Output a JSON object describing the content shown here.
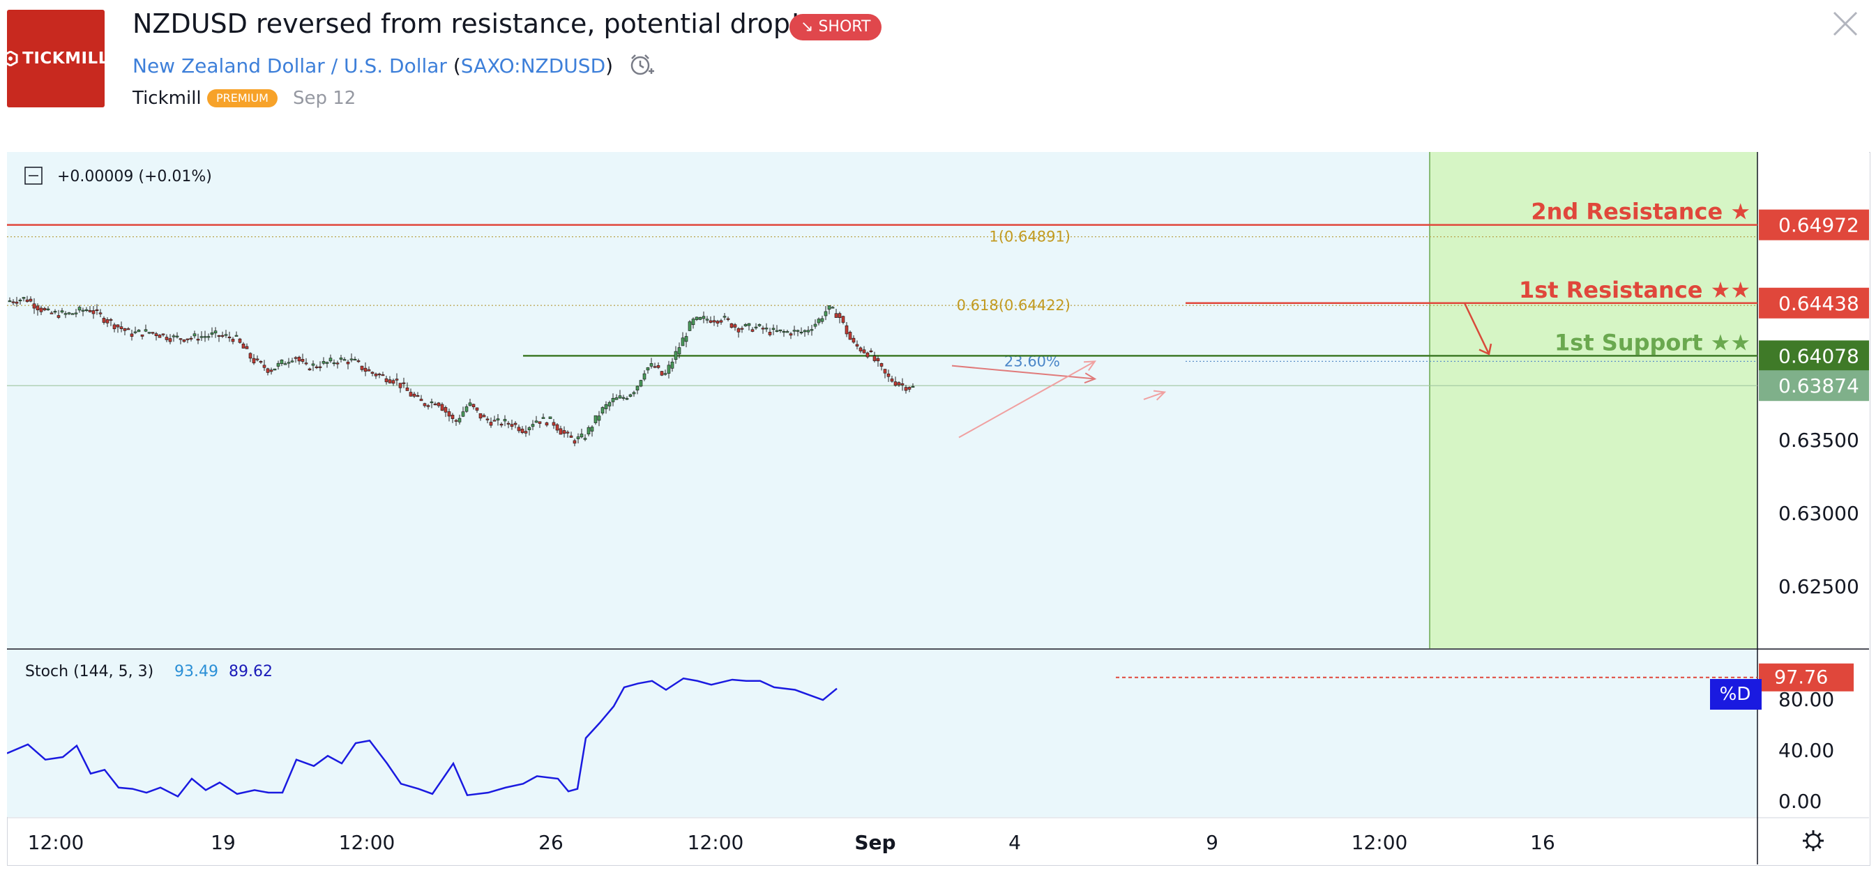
{
  "header": {
    "logo_text": "TICKMILL",
    "title": "NZDUSD reversed from resistance, potential drop!",
    "direction_badge": "SHORT",
    "symbol_name": "New Zealand Dollar / U.S. Dollar",
    "symbol_code": "SAXO:NZDUSD",
    "author": "Tickmill",
    "author_badge": "PREMIUM",
    "date": "Sep 12"
  },
  "chart_data": {
    "type": "candlestick",
    "change_label": "+0.00009 (+0.01%)",
    "yaxis_ticks": [
      "0.63500",
      "0.63000",
      "0.62500"
    ],
    "ylim": [
      0.6208,
      0.6547
    ],
    "xaxis_ticks": [
      "12:00",
      "19",
      "12:00",
      "26",
      "12:00",
      "Sep",
      "4",
      "9",
      "12:00",
      "16"
    ],
    "price_path": [
      [
        0,
        0.6445
      ],
      [
        30,
        0.6447
      ],
      [
        60,
        0.6437
      ],
      [
        90,
        0.6436
      ],
      [
        120,
        0.644
      ],
      [
        150,
        0.6431
      ],
      [
        180,
        0.6423
      ],
      [
        210,
        0.6424
      ],
      [
        240,
        0.642
      ],
      [
        265,
        0.642
      ],
      [
        300,
        0.6422
      ],
      [
        330,
        0.642
      ],
      [
        355,
        0.6405
      ],
      [
        380,
        0.6398
      ],
      [
        395,
        0.6402
      ],
      [
        415,
        0.6408
      ],
      [
        430,
        0.64
      ],
      [
        455,
        0.6402
      ],
      [
        480,
        0.6405
      ],
      [
        500,
        0.6404
      ],
      [
        520,
        0.6397
      ],
      [
        560,
        0.6391
      ],
      [
        585,
        0.638
      ],
      [
        600,
        0.6375
      ],
      [
        620,
        0.6377
      ],
      [
        645,
        0.6362
      ],
      [
        665,
        0.6375
      ],
      [
        685,
        0.6365
      ],
      [
        705,
        0.6362
      ],
      [
        725,
        0.6362
      ],
      [
        745,
        0.6357
      ],
      [
        760,
        0.6364
      ],
      [
        785,
        0.6363
      ],
      [
        800,
        0.6355
      ],
      [
        815,
        0.635
      ],
      [
        830,
        0.6352
      ],
      [
        855,
        0.637
      ],
      [
        870,
        0.6377
      ],
      [
        890,
        0.638
      ],
      [
        905,
        0.6386
      ],
      [
        918,
        0.6399
      ],
      [
        930,
        0.6401
      ],
      [
        945,
        0.6393
      ],
      [
        968,
        0.6415
      ],
      [
        985,
        0.6431
      ],
      [
        1005,
        0.6433
      ],
      [
        1030,
        0.6433
      ],
      [
        1050,
        0.6427
      ],
      [
        1080,
        0.6427
      ],
      [
        1100,
        0.6424
      ],
      [
        1125,
        0.6424
      ],
      [
        1145,
        0.6424
      ],
      [
        1165,
        0.6431
      ],
      [
        1180,
        0.644
      ],
      [
        1195,
        0.6436
      ],
      [
        1215,
        0.6416
      ],
      [
        1240,
        0.6409
      ],
      [
        1265,
        0.6393
      ],
      [
        1285,
        0.6388
      ],
      [
        1300,
        0.6386
      ]
    ],
    "horizontal_levels": [
      {
        "label": "2nd Resistance ★",
        "value": 0.64972,
        "price_label": "0.64972",
        "color": "#e0473b"
      },
      {
        "label": "1st Resistance ★★",
        "value": 0.64438,
        "price_label": "0.64438",
        "color": "#e0473b"
      },
      {
        "label": "1st Support ★★",
        "value": 0.64078,
        "price_label": "0.64078",
        "color": "#3f7a28"
      }
    ],
    "current_price": {
      "value": 0.63874,
      "price_label": "0.63874"
    },
    "fib_levels": [
      {
        "label": "1(0.64891)",
        "value": 0.64891
      },
      {
        "label": "0.618(0.64422)",
        "value": 0.64422
      }
    ],
    "fib_annotation": "23.60%",
    "stochastic": {
      "label": "Stoch (144, 5, 3)",
      "k_value": "93.49",
      "d_value": "89.62",
      "ticks": [
        "80.00",
        "40.00",
        "0.00"
      ],
      "ylim": [
        -10.0,
        110.8
      ],
      "level_label": "97.76",
      "level_value": 97.76,
      "line_tag": "%D",
      "line": [
        [
          0,
          38
        ],
        [
          30,
          45
        ],
        [
          55,
          33
        ],
        [
          80,
          35
        ],
        [
          100,
          44
        ],
        [
          120,
          22
        ],
        [
          140,
          25
        ],
        [
          160,
          11
        ],
        [
          180,
          10
        ],
        [
          200,
          7
        ],
        [
          220,
          11
        ],
        [
          245,
          4
        ],
        [
          265,
          18
        ],
        [
          285,
          9
        ],
        [
          305,
          15
        ],
        [
          330,
          6
        ],
        [
          355,
          9
        ],
        [
          375,
          7
        ],
        [
          395,
          7
        ],
        [
          415,
          33
        ],
        [
          440,
          28
        ],
        [
          460,
          36
        ],
        [
          480,
          30
        ],
        [
          500,
          46
        ],
        [
          520,
          48
        ],
        [
          545,
          30
        ],
        [
          565,
          14
        ],
        [
          590,
          10
        ],
        [
          610,
          6
        ],
        [
          640,
          30
        ],
        [
          660,
          5
        ],
        [
          690,
          7
        ],
        [
          715,
          11
        ],
        [
          740,
          14
        ],
        [
          760,
          20
        ],
        [
          790,
          18
        ],
        [
          805,
          8
        ],
        [
          818,
          10
        ],
        [
          830,
          50
        ],
        [
          850,
          62
        ],
        [
          870,
          75
        ],
        [
          885,
          90
        ],
        [
          905,
          93
        ],
        [
          925,
          95
        ],
        [
          945,
          88
        ],
        [
          970,
          97
        ],
        [
          990,
          95
        ],
        [
          1010,
          92
        ],
        [
          1040,
          96
        ],
        [
          1060,
          95
        ],
        [
          1080,
          95
        ],
        [
          1100,
          90
        ],
        [
          1130,
          88
        ],
        [
          1150,
          84
        ],
        [
          1170,
          80
        ],
        [
          1190,
          89
        ]
      ]
    },
    "legend_position": "none"
  }
}
